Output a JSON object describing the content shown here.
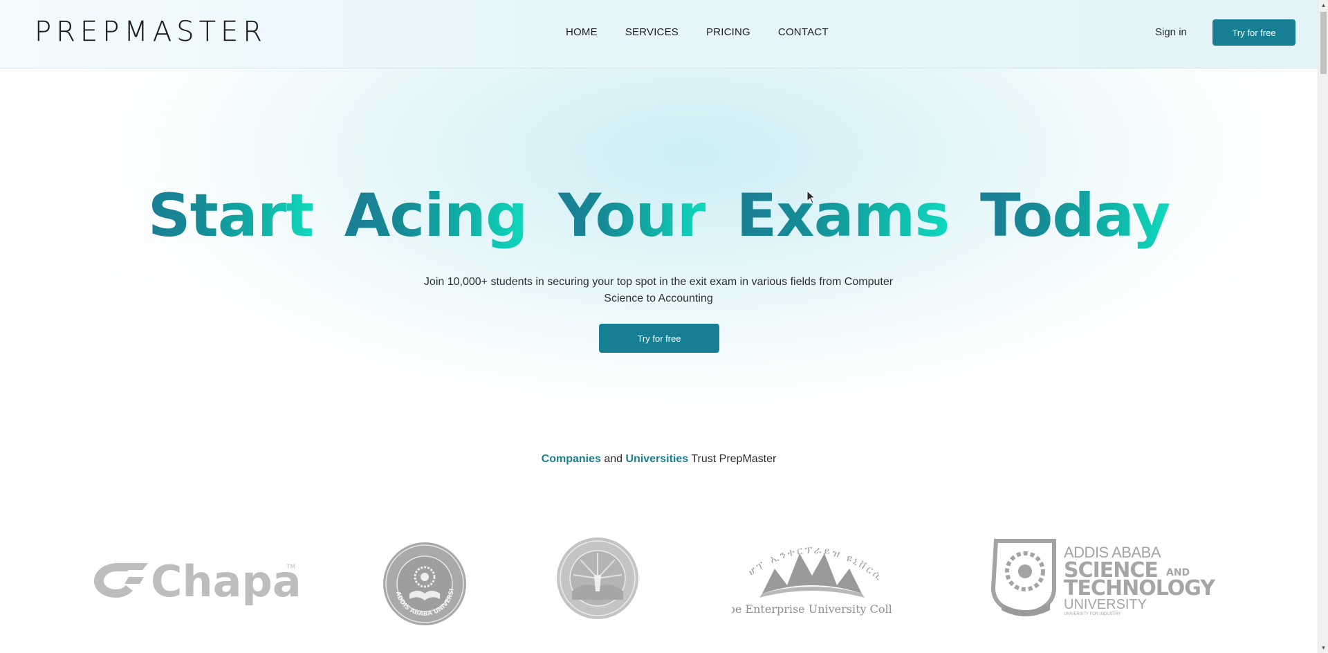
{
  "header": {
    "logo": "PREPMASTER",
    "nav": [
      "HOME",
      "SERVICES",
      "PRICING",
      "CONTACT"
    ],
    "sign_in": "Sign in",
    "cta": "Try for free"
  },
  "hero": {
    "title_words": [
      "Start",
      "Acing",
      "Your",
      "Exams",
      "Today"
    ],
    "subtitle": "Join 10,000+ students in securing your top spot in the exit exam in various fields from Computer Science to Accounting",
    "cta": "Try for free"
  },
  "trust": {
    "part1": "Companies",
    "part2": " and ",
    "part3": "Universities",
    "part4": " Trust PrepMaster"
  },
  "partners": {
    "chapa": "Chapa",
    "chapa_tm": "TM",
    "aau": "ADDIS ABABA UNIVERSITY",
    "hope": "Hope Enterprise University College",
    "astu_line1": "ADDIS ABABA",
    "astu_line2": "SCIENCE",
    "astu_and": "AND",
    "astu_line3": "TECHNOLOGY",
    "astu_line4": "UNIVERSITY",
    "astu_line5": "UNIVERSITY FOR INDUSTRY"
  },
  "colors": {
    "brand": "#177f93",
    "accent_end": "#10d9bd",
    "logo_gray": "#a9a9a9"
  }
}
